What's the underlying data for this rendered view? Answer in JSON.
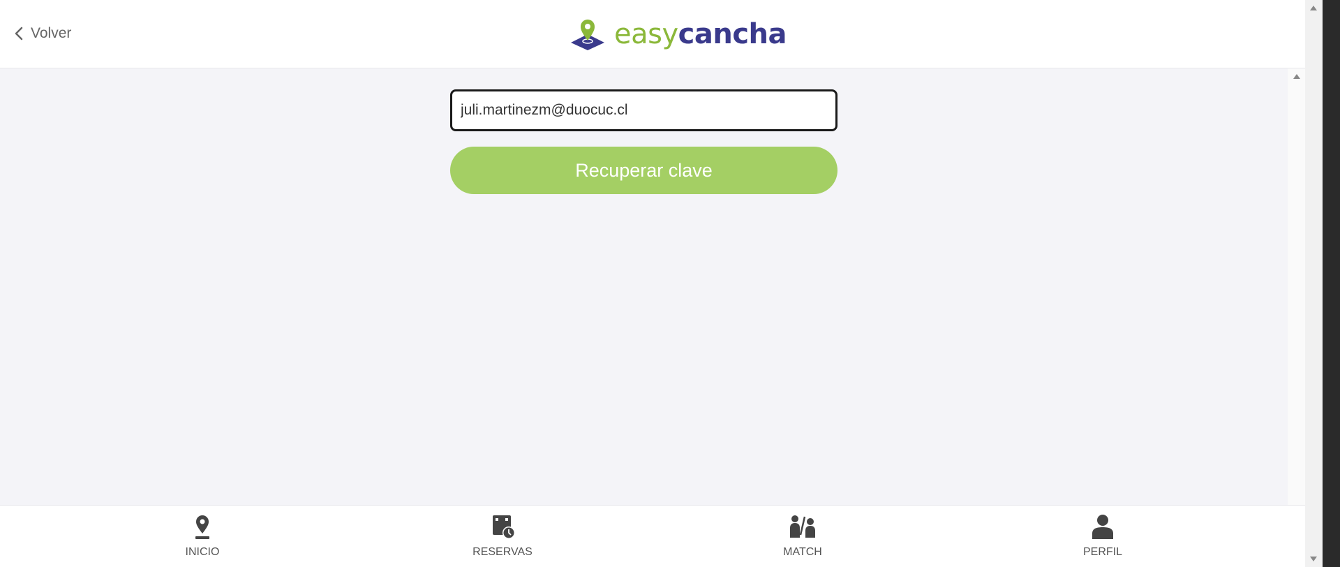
{
  "header": {
    "back_label": "Volver",
    "logo": {
      "easy": "easy",
      "cancha": "cancha"
    }
  },
  "form": {
    "email_value": "juli.martinezm@duocuc.cl",
    "submit_label": "Recuperar clave"
  },
  "nav": {
    "items": [
      {
        "label": "INICIO",
        "icon": "location-pin-icon"
      },
      {
        "label": "RESERVAS",
        "icon": "calendar-clock-icon"
      },
      {
        "label": "MATCH",
        "icon": "players-match-icon"
      },
      {
        "label": "PERFIL",
        "icon": "user-profile-icon"
      }
    ]
  },
  "colors": {
    "brand_green": "#8bb83a",
    "brand_navy": "#3a3a8c",
    "button_green": "#a4cf64",
    "background": "#f4f4f8"
  }
}
